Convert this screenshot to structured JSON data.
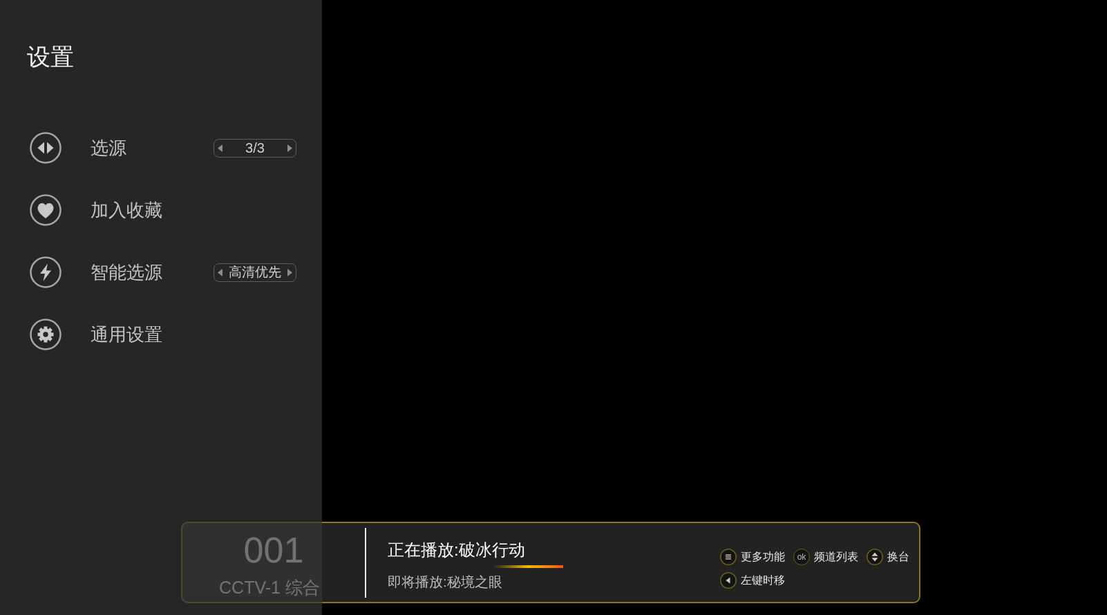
{
  "sidebar": {
    "title": "设置",
    "items": [
      {
        "label": "选源",
        "kind": "selector",
        "value": "3/3"
      },
      {
        "label": "加入收藏",
        "kind": "action"
      },
      {
        "label": "智能选源",
        "kind": "selector",
        "value": "高清优先"
      },
      {
        "label": "通用设置",
        "kind": "action"
      }
    ]
  },
  "info_bar": {
    "channel_number": "001",
    "channel_name": "CCTV-1 综合",
    "now_playing": "正在播放:破冰行动",
    "up_next": "即将播放:秘境之眼",
    "hint_rows": [
      {
        "hints": [
          {
            "kind": "icon",
            "label": "更多功能"
          },
          {
            "kind": "key",
            "key": "ok",
            "label": "频道列表"
          },
          {
            "kind": "icon",
            "label": "换台"
          }
        ]
      },
      {
        "hints": [
          {
            "kind": "icon",
            "label": "左键时移"
          }
        ]
      }
    ]
  }
}
